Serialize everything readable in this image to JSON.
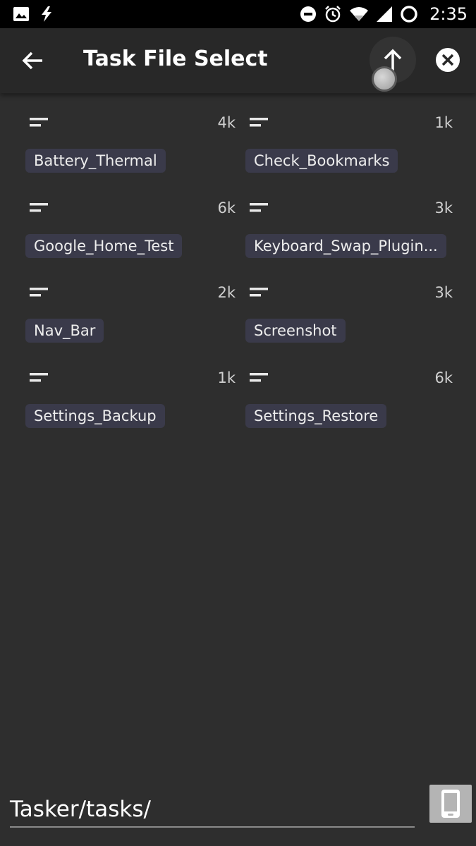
{
  "status_bar": {
    "time": "2:35",
    "icons": [
      "image-icon",
      "flash-icon",
      "do-not-disturb-icon",
      "alarm-icon",
      "wifi-icon",
      "cellular-signal-icon",
      "sync-ring-icon"
    ]
  },
  "app_bar": {
    "title": "Task File Select",
    "icons": [
      "back-arrow-icon",
      "arrow-up-icon",
      "close-circle-icon"
    ]
  },
  "files": [
    {
      "name": "Battery_Thermal",
      "size": "4k"
    },
    {
      "name": "Check_Bookmarks",
      "size": "1k"
    },
    {
      "name": "Google_Home_Test",
      "size": "6k"
    },
    {
      "name": "Keyboard_Swap_Plugin...",
      "size": "3k"
    },
    {
      "name": "Nav_Bar",
      "size": "2k"
    },
    {
      "name": "Screenshot",
      "size": "3k"
    },
    {
      "name": "Settings_Backup",
      "size": "1k"
    },
    {
      "name": "Settings_Restore",
      "size": "6k"
    }
  ],
  "path": {
    "value": "Tasker/tasks/"
  },
  "device_button": {
    "icon": "phone-device-icon"
  },
  "colors": {
    "background": "#2e2e2e",
    "app_bar": "#282828",
    "chip": "#3a3a4a",
    "status_bar": "#000000"
  }
}
